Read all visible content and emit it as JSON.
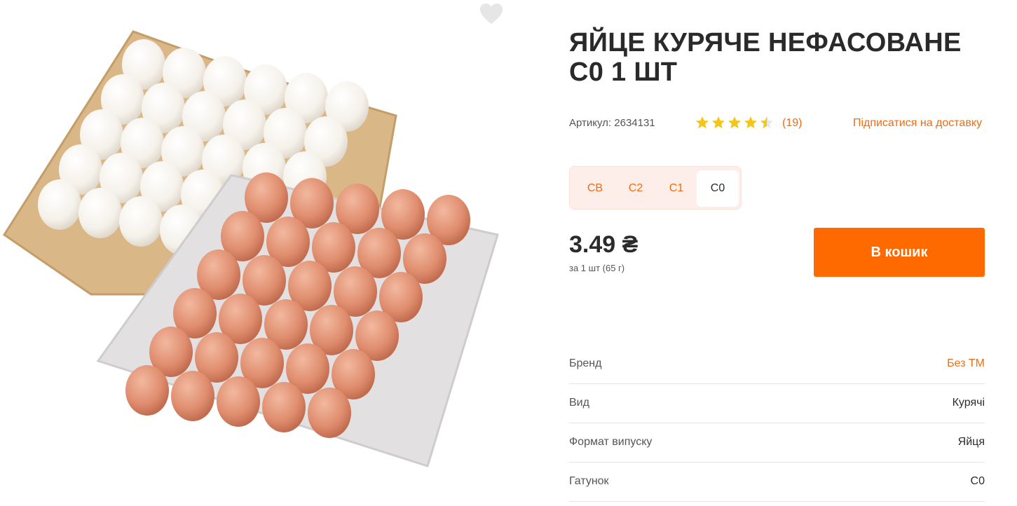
{
  "product": {
    "title": "ЯЙЦЕ КУРЯЧЕ НЕФАСОВАНЕ С0 1 ШТ",
    "sku": "Артикул: 2634131",
    "rating": 4.5,
    "reviews": "(19)",
    "subscribe_label": "Підписатися на доставку",
    "price": "3.49 ₴",
    "price_unit": "за 1 шт (65 г)",
    "cart_label": "В кошик"
  },
  "grades": {
    "items": [
      "СВ",
      "С2",
      "С1",
      "С0"
    ],
    "selected": "С0"
  },
  "attributes": [
    {
      "name": "Бренд",
      "value": "Без ТМ",
      "is_link": true
    },
    {
      "name": "Вид",
      "value": "Курячі",
      "is_link": false
    },
    {
      "name": "Формат випуску",
      "value": "Яйця",
      "is_link": false
    },
    {
      "name": "Гатунок",
      "value": "С0",
      "is_link": false
    }
  ],
  "icons": {
    "favorite": "heart-icon",
    "rating": "star-icon"
  },
  "colors": {
    "accent": "#ff6a00",
    "link": "#f26b0f",
    "star": "#f5c518",
    "grade_bg": "#fdeeea"
  }
}
